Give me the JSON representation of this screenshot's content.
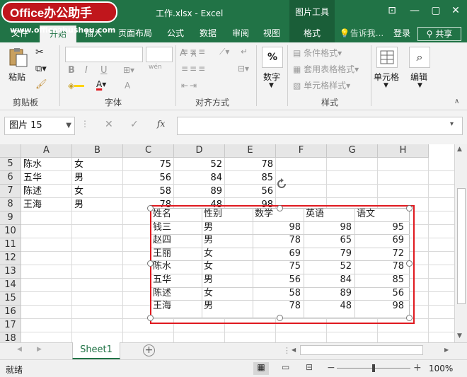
{
  "watermark": {
    "logo": "Office办公助手",
    "url": "www.officezhushou.com"
  },
  "window": {
    "title": "工作.xlsx - Excel",
    "context_tab": "图片工具",
    "minimize": "—",
    "restore": "▢",
    "close": "✕",
    "ribbon_display": "⊡"
  },
  "tabs": [
    "文件",
    "开始",
    "插入",
    "页面布局",
    "公式",
    "数据",
    "审阅",
    "视图",
    "格式"
  ],
  "tell_me": "告诉我...",
  "login": "登录",
  "share": "共享",
  "ribbon": {
    "clipboard": {
      "paste": "粘贴",
      "label": "剪贴板"
    },
    "font": {
      "bold": "B",
      "italic": "I",
      "underline": "U",
      "label": "字体",
      "grow": "A",
      "shrink": "A",
      "wen": "wén"
    },
    "alignment": {
      "label": "对齐方式"
    },
    "number": {
      "button": "数字",
      "icon": "%"
    },
    "styles": {
      "conditional": "条件格式",
      "table": "套用表格格式",
      "cell_styles": "单元格样式",
      "label": "样式"
    },
    "cells": {
      "button": "单元格"
    },
    "editing": {
      "button": "编辑"
    }
  },
  "formula_bar": {
    "name_box": "图片 15",
    "fx": "fx",
    "value": ""
  },
  "grid": {
    "columns": [
      "A",
      "B",
      "C",
      "D",
      "E",
      "F",
      "G",
      "H"
    ],
    "rows": [
      "5",
      "6",
      "7",
      "8",
      "9",
      "10",
      "11",
      "12",
      "13",
      "14",
      "15",
      "16",
      "17",
      "18"
    ],
    "data": [
      [
        "陈水",
        "女",
        "75",
        "52",
        "78"
      ],
      [
        "五华",
        "男",
        "56",
        "84",
        "85"
      ],
      [
        "陈述",
        "女",
        "58",
        "89",
        "56"
      ],
      [
        "王海",
        "男",
        "78",
        "48",
        "98"
      ]
    ]
  },
  "picture": {
    "headers": [
      "姓名",
      "性别",
      "数学",
      "英语",
      "语文"
    ],
    "rows": [
      [
        "钱三",
        "男",
        "98",
        "98",
        "95"
      ],
      [
        "赵四",
        "男",
        "78",
        "65",
        "69"
      ],
      [
        "王丽",
        "女",
        "69",
        "79",
        "72"
      ],
      [
        "陈水",
        "女",
        "75",
        "52",
        "78"
      ],
      [
        "五华",
        "男",
        "56",
        "84",
        "85"
      ],
      [
        "陈述",
        "女",
        "58",
        "89",
        "56"
      ],
      [
        "王海",
        "男",
        "78",
        "48",
        "98"
      ]
    ]
  },
  "sheet": {
    "tab": "Sheet1",
    "add": "+"
  },
  "status": {
    "ready": "就绪",
    "zoom": "100%",
    "minus": "−",
    "plus": "+"
  },
  "colors": {
    "excel_green": "#217346",
    "selection_border": "#e0191f",
    "logo_red": "#c0161c"
  }
}
